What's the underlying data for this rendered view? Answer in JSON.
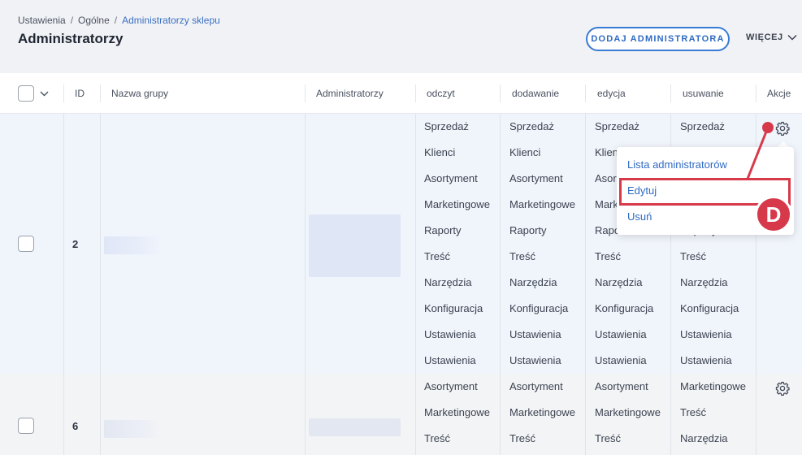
{
  "breadcrumb": {
    "items": [
      "Ustawienia",
      "Ogólne",
      "Administratorzy sklepu"
    ],
    "separator": "/"
  },
  "page_title": "Administratorzy",
  "toolbar": {
    "add_label": "DODAJ ADMINISTRATORA",
    "more_label": "WIĘCEJ"
  },
  "table": {
    "headers": {
      "id": "ID",
      "group_name": "Nazwa grupy",
      "admins": "Administratorzy",
      "read": "odczyt",
      "add": "dodawanie",
      "edit": "edycja",
      "delete": "usuwanie",
      "actions": "Akcje"
    },
    "rows": [
      {
        "id": "2",
        "read": [
          "Sprzedaż",
          "Klienci",
          "Asortyment",
          "Marketingowe",
          "Raporty",
          "Treść",
          "Narzędzia",
          "Konfiguracja",
          "Ustawienia",
          "Ustawienia"
        ],
        "add": [
          "Sprzedaż",
          "Klienci",
          "Asortyment",
          "Marketingowe",
          "Raporty",
          "Treść",
          "Narzędzia",
          "Konfiguracja",
          "Ustawienia",
          "Ustawienia"
        ],
        "edit": [
          "Sprzedaż",
          "Klien",
          "Asor",
          "Mark",
          "Rapo",
          "Treść",
          "Narzędzia",
          "Konfiguracja",
          "Ustawienia",
          "Ustawienia"
        ],
        "delete": [
          "Sprzedaż",
          "",
          "",
          "",
          "Raporty",
          "Treść",
          "Narzędzia",
          "Konfiguracja",
          "Ustawienia",
          "Ustawienia"
        ]
      },
      {
        "id": "6",
        "read": [
          "Asortyment",
          "Marketingowe",
          "Treść"
        ],
        "add": [
          "Asortyment",
          "Marketingowe",
          "Treść"
        ],
        "edit": [
          "Asortyment",
          "Marketingowe",
          "Treść"
        ],
        "delete": [
          "Marketingowe",
          "Treść",
          "Narzędzia"
        ]
      }
    ]
  },
  "dropdown": {
    "items": [
      "Lista administratorów",
      "Edytuj",
      "Usuń"
    ]
  },
  "annotation": {
    "badge": "D",
    "color": "#d63a4a"
  },
  "icons": [
    "chevron-down-icon",
    "gear-icon"
  ],
  "colors": {
    "accent": "#2f6ac4",
    "row_selected": "#f0f4fb"
  }
}
